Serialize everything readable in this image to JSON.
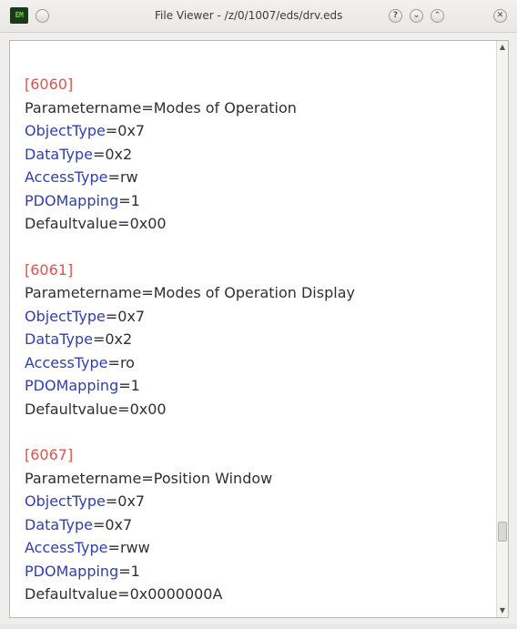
{
  "window": {
    "title": "File Viewer - /z/0/1007/eds/drv.eds",
    "app_icon_text": "EM",
    "buttons": {
      "help": "?",
      "minimize": "⌄",
      "maximize": "⌃",
      "close": "✕"
    }
  },
  "colors": {
    "section_header": "#e8504a",
    "key_highlight": "#2f3fb0",
    "text": "#2f2f2f"
  },
  "sections": [
    {
      "header": "[6060]",
      "lines": [
        {
          "key": "Parametername",
          "value": "=Modes of Operation",
          "highlight": false
        },
        {
          "key": "ObjectType",
          "value": "=0x7",
          "highlight": true
        },
        {
          "key": "DataType",
          "value": "=0x2",
          "highlight": true
        },
        {
          "key": "AccessType",
          "value": "=rw",
          "highlight": true
        },
        {
          "key": "PDOMapping",
          "value": "=1",
          "highlight": true
        },
        {
          "key": "Defaultvalue",
          "value": "=0x00",
          "highlight": false
        }
      ]
    },
    {
      "header": "[6061]",
      "lines": [
        {
          "key": "Parametername",
          "value": "=Modes of Operation Display",
          "highlight": false
        },
        {
          "key": "ObjectType",
          "value": "=0x7",
          "highlight": true
        },
        {
          "key": "DataType",
          "value": "=0x2",
          "highlight": true
        },
        {
          "key": "AccessType",
          "value": "=ro",
          "highlight": true
        },
        {
          "key": "PDOMapping",
          "value": "=1",
          "highlight": true
        },
        {
          "key": "Defaultvalue",
          "value": "=0x00",
          "highlight": false
        }
      ]
    },
    {
      "header": "[6067]",
      "lines": [
        {
          "key": "Parametername",
          "value": "=Position Window",
          "highlight": false
        },
        {
          "key": "ObjectType",
          "value": "=0x7",
          "highlight": true
        },
        {
          "key": "DataType",
          "value": "=0x7",
          "highlight": true
        },
        {
          "key": "AccessType",
          "value": "=rww",
          "highlight": true
        },
        {
          "key": "PDOMapping",
          "value": "=1",
          "highlight": true
        },
        {
          "key": "Defaultvalue",
          "value": "=0x0000000A",
          "highlight": false
        }
      ]
    }
  ],
  "scrollbar": {
    "up_arrow": "▲",
    "down_arrow": "▼"
  }
}
